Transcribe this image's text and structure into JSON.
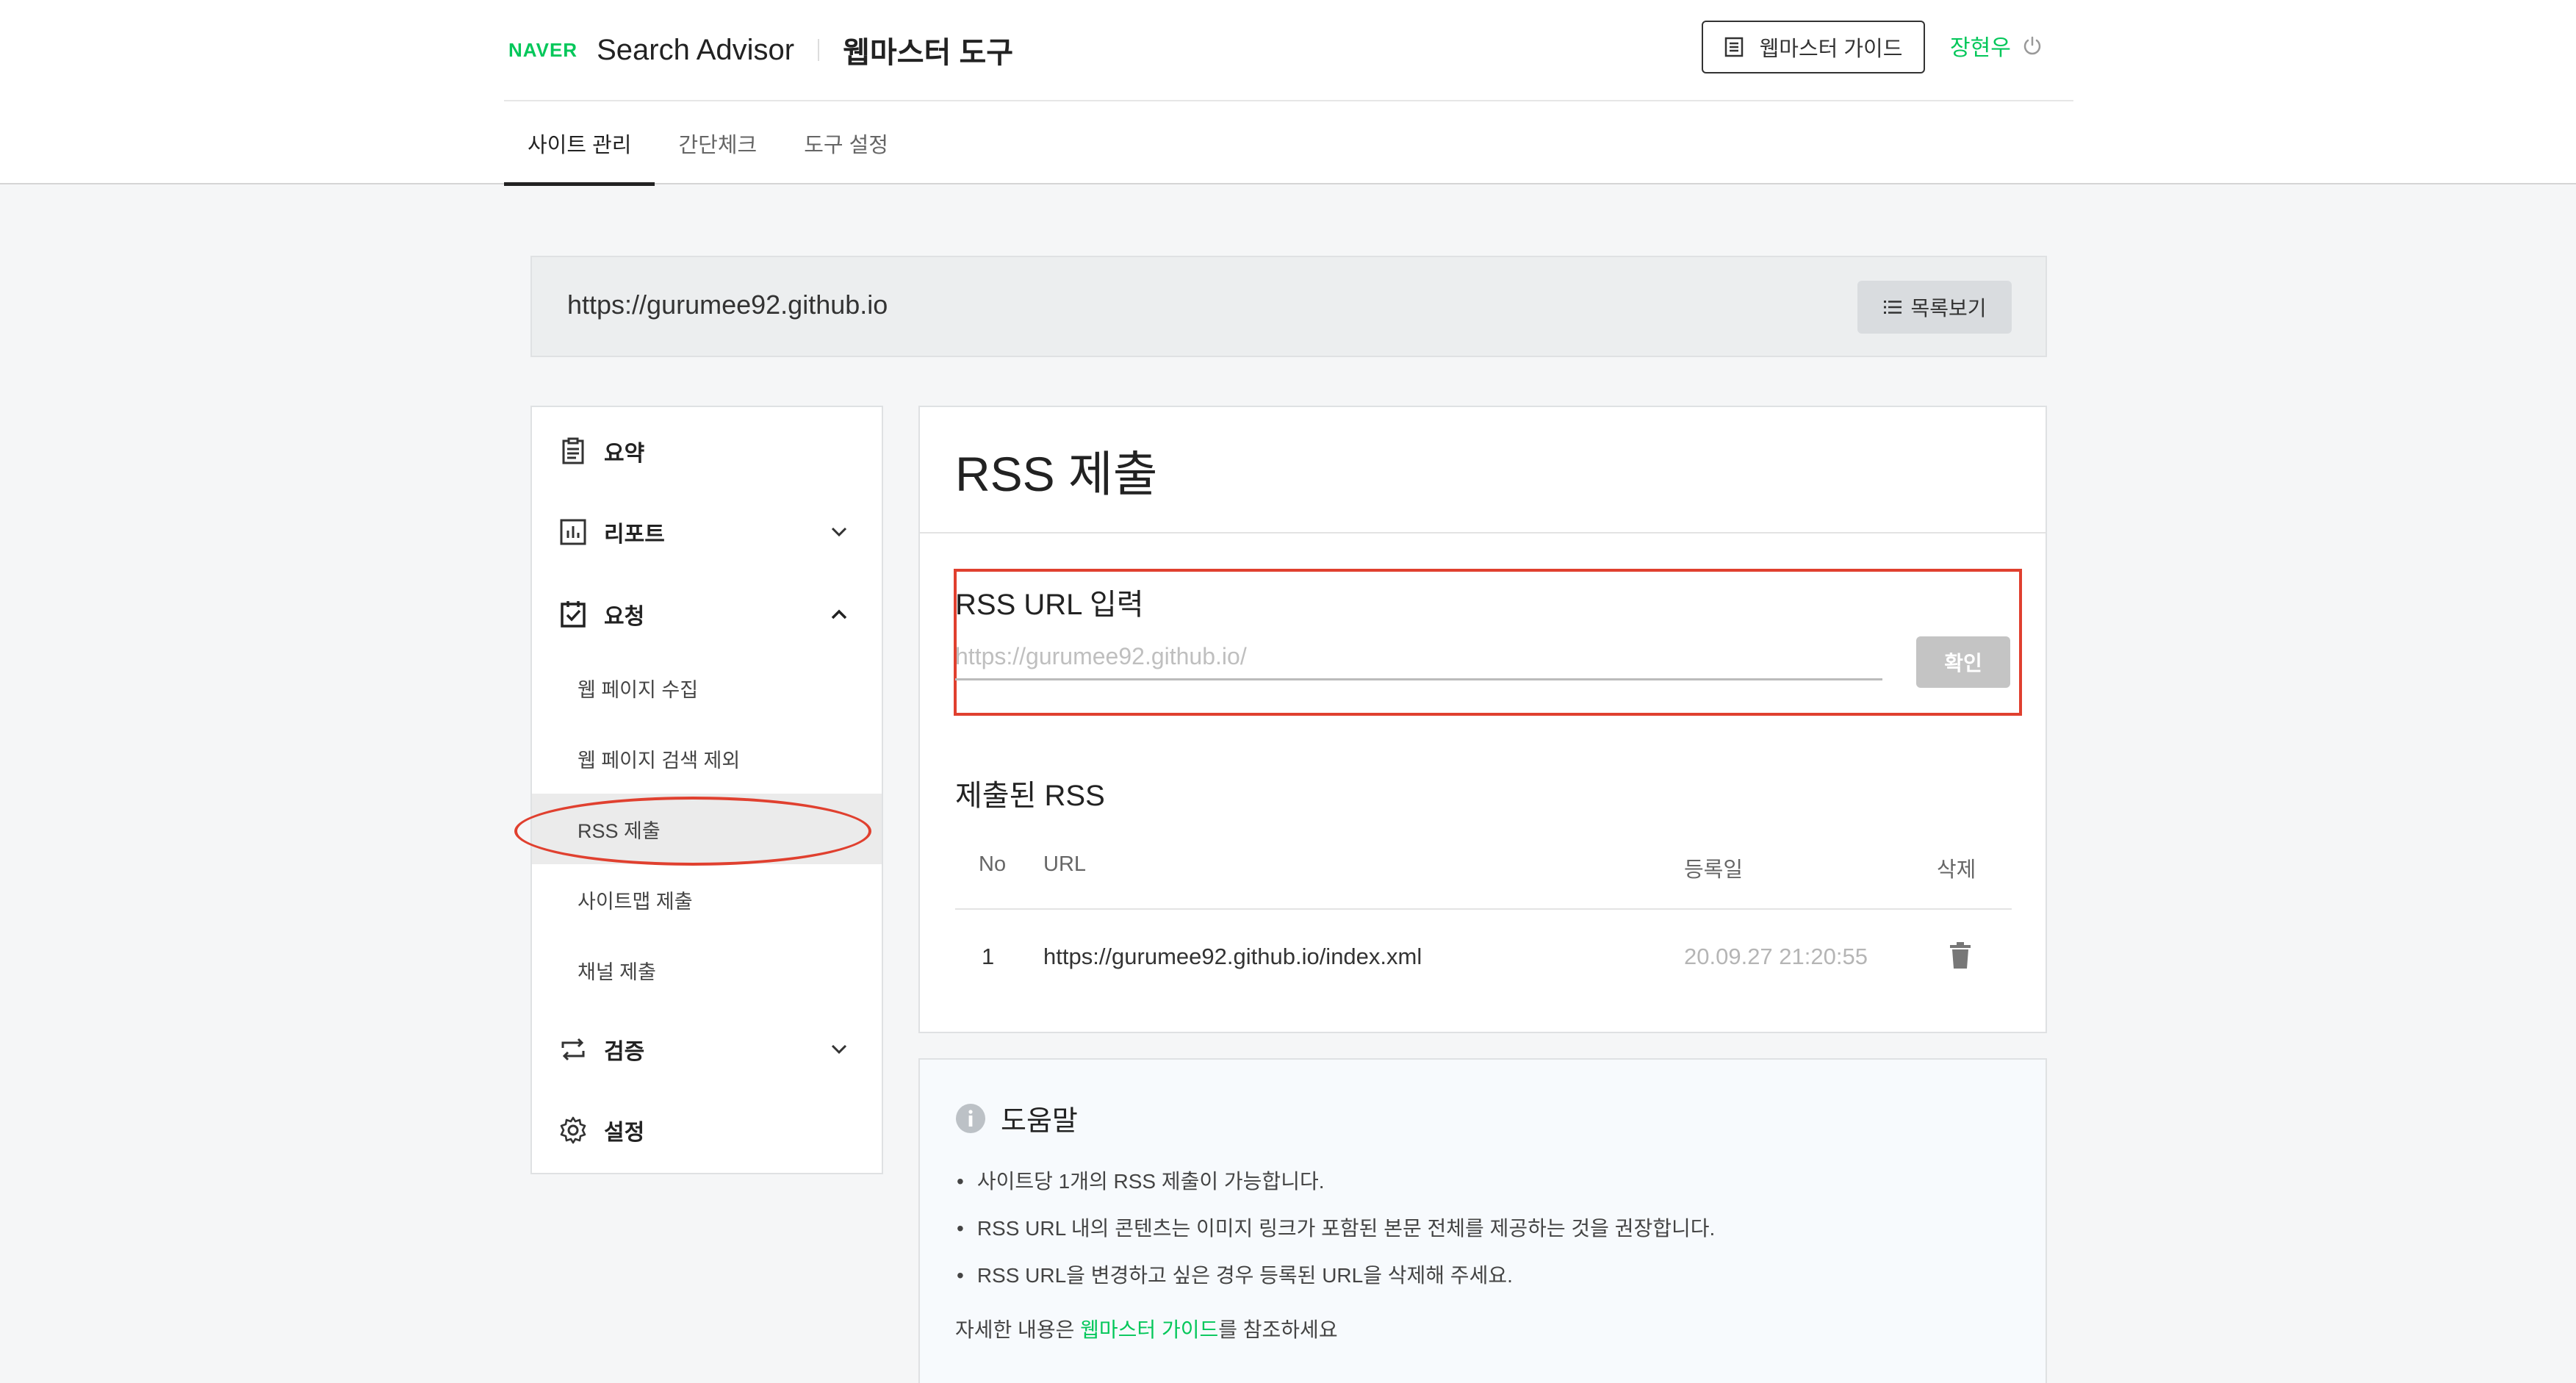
{
  "header": {
    "brand_logo": "NAVER",
    "brand_title": "Search Advisor",
    "brand_sub": "웹마스터 도구",
    "guide_button": "웹마스터 가이드",
    "user_name": "장현우"
  },
  "tabs": [
    {
      "label": "사이트 관리",
      "active": true
    },
    {
      "label": "간단체크",
      "active": false
    },
    {
      "label": "도구 설정",
      "active": false
    }
  ],
  "site": {
    "url": "https://gurumee92.github.io",
    "list_button": "목록보기"
  },
  "sidebar": {
    "summary": "요약",
    "report": "리포트",
    "request": "요청",
    "request_items": [
      {
        "label": "웹 페이지 수집"
      },
      {
        "label": "웹 페이지 검색 제외"
      },
      {
        "label": "RSS 제출",
        "active": true
      },
      {
        "label": "사이트맵 제출"
      },
      {
        "label": "채널 제출"
      }
    ],
    "verify": "검증",
    "settings": "설정"
  },
  "main": {
    "title": "RSS 제출",
    "input_label": "RSS URL 입력",
    "input_placeholder": "https://gurumee92.github.io/",
    "confirm_button": "확인",
    "submitted_title": "제출된 RSS",
    "table": {
      "headers": [
        "No",
        "URL",
        "등록일",
        "삭제"
      ],
      "rows": [
        {
          "no": "1",
          "url": "https://gurumee92.github.io/index.xml",
          "date": "20.09.27 21:20:55"
        }
      ]
    }
  },
  "help": {
    "title": "도움말",
    "items": [
      "사이트당 1개의 RSS 제출이 가능합니다.",
      "RSS URL 내의 콘텐츠는 이미지 링크가 포함된 본문 전체를 제공하는 것을 권장합니다.",
      "RSS URL을 변경하고 싶은 경우 등록된 URL을 삭제해 주세요."
    ],
    "more_prefix": "자세한 내용은 ",
    "more_link": "웹마스터 가이드",
    "more_suffix": "를 참조하세요"
  },
  "colors": {
    "brand_green": "#03c75a",
    "annotation_red": "#e0402f",
    "active_menu_bg": "#ebebeb"
  }
}
